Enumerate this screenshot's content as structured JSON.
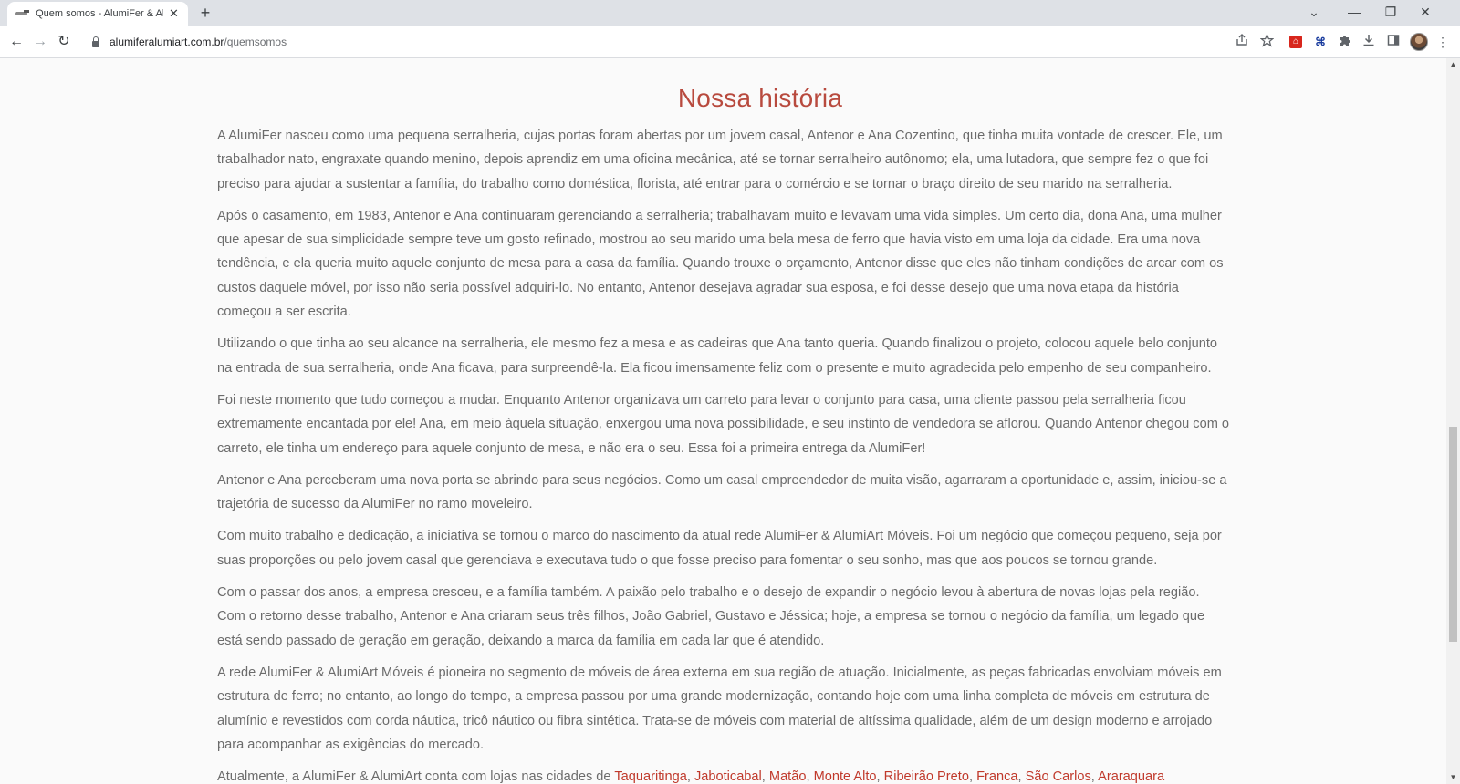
{
  "browser": {
    "tab_title": "Quem somos - AlumiFer & AlumiArt",
    "tab_close": "✕",
    "new_tab": "+",
    "url_host": "alumiferalumiart.com.br",
    "url_path": "/quemsomos",
    "controls": {
      "menu_down": "⌄",
      "minimize": "—",
      "restore": "❐",
      "close": "✕"
    },
    "nav": {
      "back": "←",
      "forward": "→",
      "reload": "↻"
    },
    "icons": [
      "share-icon",
      "star-icon",
      "pdf-extension-icon",
      "translate-extension-icon",
      "puzzle-extensions-icon",
      "download-icon",
      "side-panel-icon",
      "profile-avatar",
      "kebab-menu-icon"
    ]
  },
  "page": {
    "title": "Nossa história",
    "paragraphs": [
      "A AlumiFer nasceu como uma pequena serralheria, cujas portas foram abertas por um jovem casal, Antenor e Ana Cozentino, que tinha muita vontade de crescer. Ele, um trabalhador nato, engraxate quando menino, depois aprendiz em uma oficina mecânica, até se tornar serralheiro autônomo; ela, uma lutadora, que sempre fez o que foi preciso para ajudar a sustentar a família, do trabalho como doméstica, florista, até entrar para o comércio e se tornar o braço direito de seu marido na serralheria.",
      "Após o casamento, em 1983, Antenor e Ana continuaram gerenciando a serralheria; trabalhavam muito e levavam uma vida simples. Um certo dia, dona Ana, uma mulher que apesar de sua simplicidade sempre teve um gosto refinado, mostrou ao seu marido uma bela mesa de ferro que havia visto em uma loja da cidade. Era uma nova tendência, e ela queria muito aquele conjunto de mesa para a casa da família. Quando trouxe o orçamento, Antenor disse que eles não tinham condições de arcar com os custos daquele móvel, por isso não seria possível adquiri-lo. No entanto, Antenor desejava agradar sua esposa, e foi desse desejo que uma nova etapa da história começou a ser escrita.",
      "Utilizando o que tinha ao seu alcance na serralheria, ele mesmo fez a mesa e as cadeiras que Ana tanto queria. Quando finalizou o projeto, colocou aquele belo conjunto na entrada de sua serralheria, onde Ana ficava, para surpreendê-la. Ela ficou imensamente feliz com o presente e muito agradecida pelo empenho de seu companheiro.",
      "Foi neste momento que tudo começou a mudar. Enquanto Antenor organizava um carreto para levar o conjunto para casa, uma cliente passou pela serralheria ficou extremamente encantada por ele! Ana, em meio àquela situação, enxergou uma nova possibilidade, e seu instinto de vendedora se aflorou. Quando Antenor chegou com o carreto, ele tinha um endereço para aquele conjunto de mesa, e não era o seu. Essa foi a primeira entrega da AlumiFer!",
      "Antenor e Ana perceberam uma nova porta se abrindo para seus negócios. Como um casal empreendedor de muita visão, agarraram a oportunidade e, assim, iniciou-se a trajetória de sucesso da AlumiFer no ramo moveleiro.",
      "Com muito trabalho e dedicação, a iniciativa se tornou o marco do nascimento da atual rede AlumiFer & AlumiArt Móveis. Foi um negócio que começou pequeno, seja por suas proporções ou pelo jovem casal que gerenciava e executava tudo o que fosse preciso para fomentar o seu sonho, mas que aos poucos se tornou grande.",
      "Com o passar dos anos, a empresa cresceu, e a família também. A paixão pelo trabalho e o desejo de expandir o negócio levou à abertura de novas lojas pela região. Com o retorno desse trabalho, Antenor e Ana criaram seus três filhos, João Gabriel, Gustavo e Jéssica; hoje, a empresa se tornou o negócio da família, um legado que está sendo passado de geração em geração, deixando a marca da família em cada lar que é atendido.",
      "A rede AlumiFer & AlumiArt Móveis é pioneira no segmento de móveis de área externa em sua região de atuação. Inicialmente, as peças fabricadas envolviam móveis em estrutura de ferro; no entanto, ao longo do tempo, a empresa passou por uma grande modernização, contando hoje com uma linha completa de móveis em estrutura de alumínio e revestidos com corda náutica, tricô náutico ou fibra sintética. Trata-se de móveis com material de altíssima qualidade, além de um design moderno e arrojado para acompanhar as exigências do mercado."
    ],
    "partial_line_start": "Atualmente, a AlumiFer & AlumiArt conta com lojas nas cidades de ",
    "partial_links": [
      "Taquaritinga",
      "Jaboticabal",
      "Matão",
      "Monte Alto",
      "Ribeirão Preto",
      "Franca",
      "São Carlos",
      "Araraquara"
    ]
  }
}
